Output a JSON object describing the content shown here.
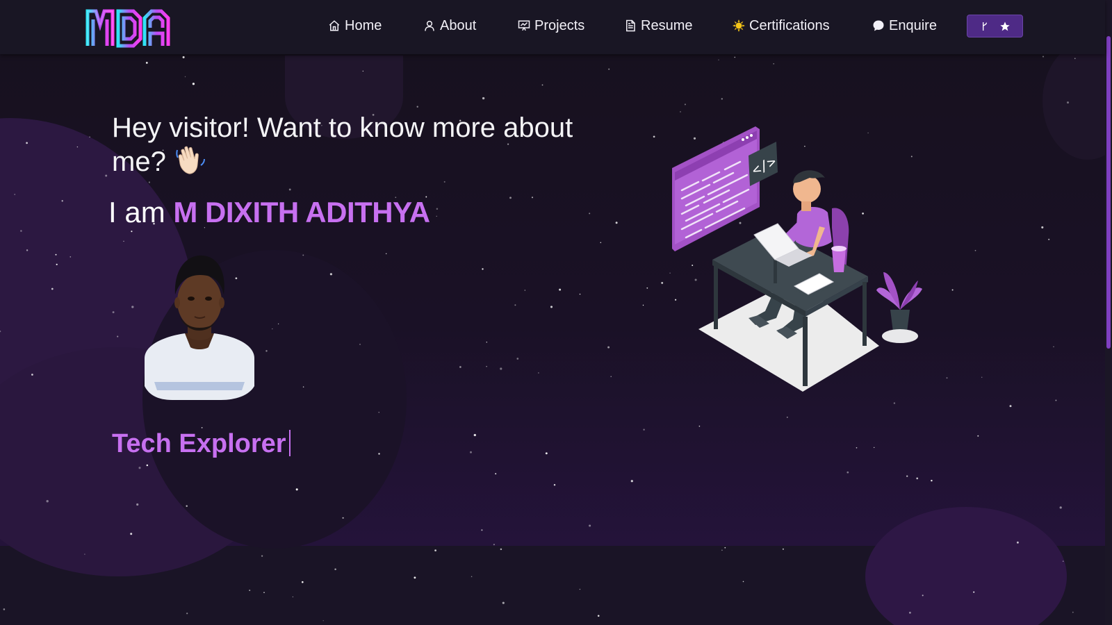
{
  "colors": {
    "accent": "#c770f0",
    "navbar": "#191624",
    "background": "#140f1f",
    "button": "#4e2a86"
  },
  "logo": {
    "text": "MDA"
  },
  "nav": {
    "items": [
      {
        "label": "Home",
        "icon": "home-icon"
      },
      {
        "label": "About",
        "icon": "user-icon"
      },
      {
        "label": "Projects",
        "icon": "presentation-icon"
      },
      {
        "label": "Resume",
        "icon": "document-icon"
      },
      {
        "label": "Certifications",
        "icon": "sun-badge-icon"
      },
      {
        "label": "Enquire",
        "icon": "chat-bubble-icon"
      }
    ],
    "github_button": {
      "icons": [
        "git-fork-icon",
        "star-icon"
      ]
    }
  },
  "hero": {
    "greeting": "Hey visitor! Want to know more about me?",
    "greeting_emoji": "waving-hand-icon",
    "intro_prefix": "I am",
    "name": "M DIXITH ADITHYA",
    "typed_text": "Tech Explorer",
    "illustration": "developer-at-desk-illustration"
  }
}
